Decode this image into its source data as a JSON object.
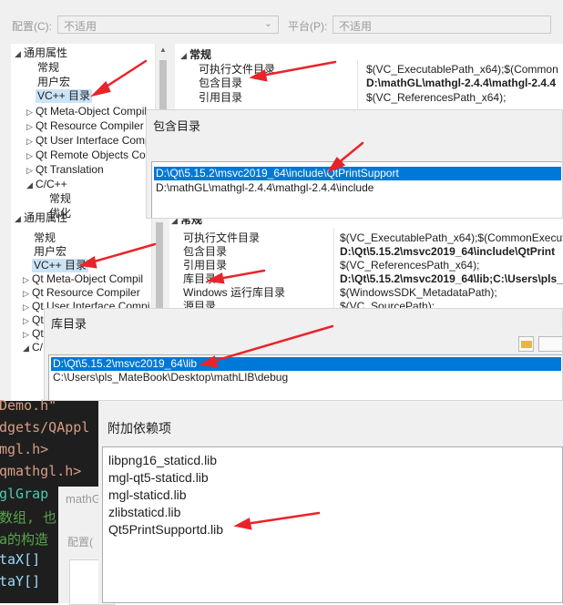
{
  "panel1": {
    "config_label": "配置(C):",
    "config_value": "不适用",
    "platform_label": "平台(P):",
    "platform_value": "不适用",
    "tree": [
      "通用属性",
      "常规",
      "用户宏",
      "VC++ 目录",
      "Qt Meta-Object Compil",
      "Qt Resource Compiler",
      "Qt User Interface Comp",
      "Qt Remote Objects Co",
      "Qt Translation",
      "C/C++",
      "常规",
      "优化"
    ],
    "section": "常规",
    "props": [
      {
        "name": "可执行文件目录",
        "value": "$(VC_ExecutablePath_x64);$(Common"
      },
      {
        "name": "包含目录",
        "value": "D:\\mathGL\\mathgl-2.4.4\\mathgl-2.4.4"
      },
      {
        "name": "引用目录",
        "value": "$(VC_ReferencesPath_x64);"
      }
    ],
    "dialog_title": "包含目录",
    "dialog_items": [
      "D:\\Qt\\5.15.2\\msvc2019_64\\include\\QtPrintSupport",
      "D:\\mathGL\\mathgl-2.4.4\\mathgl-2.4.4\\include"
    ]
  },
  "panel2": {
    "tree": [
      "通用属性",
      "常规",
      "用户宏",
      "VC++ 目录",
      "Qt Meta-Object Compil",
      "Qt Resource Compiler",
      "Qt User Interface Compi",
      "Qt",
      "Qt",
      "C/"
    ],
    "section": "常规",
    "props": [
      {
        "name": "可执行文件目录",
        "value": "$(VC_ExecutablePath_x64);$(CommonExecuta"
      },
      {
        "name": "包含目录",
        "value": "D:\\Qt\\5.15.2\\msvc2019_64\\include\\QtPrint"
      },
      {
        "name": "引用目录",
        "value": "$(VC_ReferencesPath_x64);"
      },
      {
        "name": "库目录",
        "value": "D:\\Qt\\5.15.2\\msvc2019_64\\lib;C:\\Users\\pls_"
      },
      {
        "name": "Windows 运行库目录",
        "value": "$(WindowsSDK_MetadataPath);"
      },
      {
        "name": "源目录",
        "value": "$(VC_SourcePath);"
      }
    ],
    "dialog_title": "库目录",
    "dialog_items": [
      "D:\\Qt\\5.15.2\\msvc2019_64\\lib",
      "C:\\Users\\pls_MateBook\\Desktop\\mathLIB\\debug"
    ]
  },
  "panel3": {
    "code_lines": [
      "Demo.h\"",
      "dgets/QAppl",
      "mgl.h>",
      "qmathgl.h>",
      "glGrap",
      "数组, 也",
      "a的构造",
      "taX[]",
      "taY[]"
    ],
    "under_title": "mathG",
    "under_label": "配置(",
    "dialog_title": "附加依赖项",
    "deps": [
      "libpng16_staticd.lib",
      "mgl-qt5-staticd.lib",
      "mgl-staticd.lib",
      "zlibstaticd.lib",
      "Qt5PrintSupportd.lib"
    ]
  },
  "colors": {
    "selection": "#0078d7",
    "tree_selection": "#cce4f7",
    "arrow": "#e8242b",
    "code_bg": "#1e1e1e",
    "code_green": "#57a64a"
  }
}
